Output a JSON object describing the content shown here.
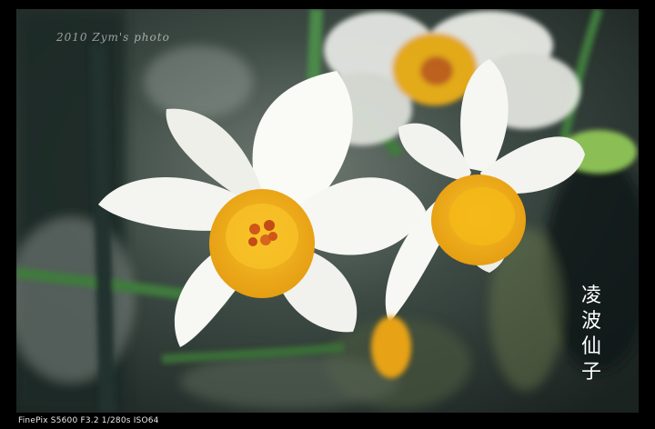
{
  "photo": {
    "subject": "narcissus-flowers",
    "watermark": "2010 Zym's photo",
    "title_chars": [
      "凌",
      "波",
      "仙",
      "子"
    ]
  },
  "caption": {
    "exif": "FinePix S5600 F3.2 1/280s ISO64"
  },
  "colors": {
    "frame": "#000000",
    "petal": "#f7f7f4",
    "corona": "#f2b21a",
    "stamen": "#c8501a",
    "stem": "#3f7a3d",
    "background": "#2b3a34"
  }
}
